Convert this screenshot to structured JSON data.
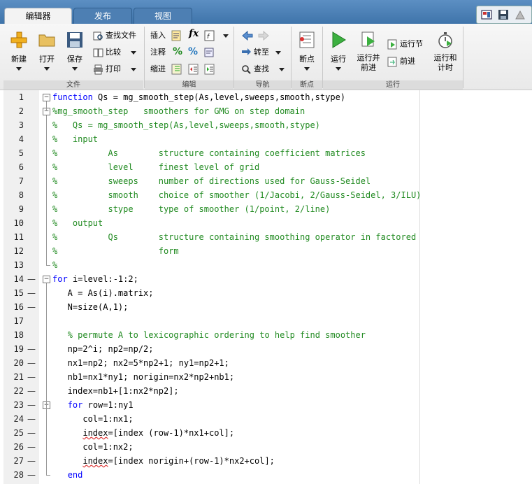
{
  "tabs": [
    {
      "label": "编辑器",
      "active": true
    },
    {
      "label": "发布",
      "active": false
    },
    {
      "label": "视图",
      "active": false
    }
  ],
  "quick_access": [
    "layout-icon",
    "save-icon",
    "help-icon"
  ],
  "ribbon": {
    "file": {
      "new": "新建",
      "open": "打开",
      "save": "保存",
      "find_files": "查找文件",
      "compare": "比较",
      "print": "打印",
      "group": "文件"
    },
    "edit": {
      "insert": "插入",
      "comment": "注释",
      "indent": "缩进",
      "group": "编辑"
    },
    "navigate": {
      "goto": "转至",
      "find": "查找",
      "group": "导航"
    },
    "breakpoints": {
      "breakpoint": "断点",
      "group": "断点"
    },
    "run": {
      "run": "运行",
      "run_advance": "运行并\n前进",
      "run_section": "运行节",
      "advance": "前进",
      "run_time": "运行和\n计时",
      "group": "运行"
    }
  },
  "colors": {
    "keyword": "#0000ff",
    "comment": "#228b22",
    "tab_bar": "#4a7fb5"
  },
  "code_lines": [
    {
      "n": "1",
      "dash": false,
      "fold": "minus",
      "parts": [
        [
          "kw",
          "function"
        ],
        [
          "t",
          " Qs = mg_smooth_step(As,level,sweeps,smooth,stype)"
        ]
      ]
    },
    {
      "n": "2",
      "dash": false,
      "fold": "minus",
      "parts": [
        [
          "cm",
          "%mg_smooth_step   smoothers for GMG on step domain"
        ]
      ]
    },
    {
      "n": "3",
      "dash": false,
      "fold": "",
      "parts": [
        [
          "cm",
          "%   Qs = mg_smooth_step(As,level,sweeps,smooth,stype)"
        ]
      ]
    },
    {
      "n": "4",
      "dash": false,
      "fold": "",
      "parts": [
        [
          "cm",
          "%   input"
        ]
      ]
    },
    {
      "n": "5",
      "dash": false,
      "fold": "",
      "parts": [
        [
          "cm",
          "%          As        structure containing coefficient matrices"
        ]
      ]
    },
    {
      "n": "6",
      "dash": false,
      "fold": "",
      "parts": [
        [
          "cm",
          "%          level     finest level of grid"
        ]
      ]
    },
    {
      "n": "7",
      "dash": false,
      "fold": "",
      "parts": [
        [
          "cm",
          "%          sweeps    number of directions used for Gauss-Seidel"
        ]
      ]
    },
    {
      "n": "8",
      "dash": false,
      "fold": "",
      "parts": [
        [
          "cm",
          "%          smooth    choice of smoother (1/Jacobi, 2/Gauss-Seidel, 3/ILU)"
        ]
      ]
    },
    {
      "n": "9",
      "dash": false,
      "fold": "",
      "parts": [
        [
          "cm",
          "%          stype     type of smoother (1/point, 2/line)"
        ]
      ]
    },
    {
      "n": "10",
      "dash": false,
      "fold": "",
      "parts": [
        [
          "cm",
          "%   output"
        ]
      ]
    },
    {
      "n": "11",
      "dash": false,
      "fold": "",
      "parts": [
        [
          "cm",
          "%          Qs        structure containing smoothing operator in factored"
        ]
      ]
    },
    {
      "n": "12",
      "dash": false,
      "fold": "",
      "parts": [
        [
          "cm",
          "%                    form"
        ]
      ]
    },
    {
      "n": "13",
      "dash": false,
      "fold": "end",
      "parts": [
        [
          "cm",
          "%"
        ]
      ]
    },
    {
      "n": "14",
      "dash": true,
      "fold": "minus",
      "parts": [
        [
          "kw",
          "for"
        ],
        [
          "t",
          " i=level:-1:2;"
        ]
      ]
    },
    {
      "n": "15",
      "dash": true,
      "fold": "",
      "parts": [
        [
          "t",
          "   A = As(i).matrix;"
        ]
      ]
    },
    {
      "n": "16",
      "dash": true,
      "fold": "",
      "parts": [
        [
          "t",
          "   N=size(A,1);"
        ]
      ]
    },
    {
      "n": "17",
      "dash": false,
      "fold": "",
      "parts": [
        [
          "t",
          ""
        ]
      ]
    },
    {
      "n": "18",
      "dash": false,
      "fold": "",
      "parts": [
        [
          "t",
          "   "
        ],
        [
          "cm",
          "% permute A to lexicographic ordering to help find smoother"
        ]
      ]
    },
    {
      "n": "19",
      "dash": true,
      "fold": "",
      "parts": [
        [
          "t",
          "   np=2^i; np2=np/2;"
        ]
      ]
    },
    {
      "n": "20",
      "dash": true,
      "fold": "",
      "parts": [
        [
          "t",
          "   nx1=np2; nx2=5*np2+1; ny1=np2+1;"
        ]
      ]
    },
    {
      "n": "21",
      "dash": true,
      "fold": "",
      "parts": [
        [
          "t",
          "   nb1=nx1*ny1; norigin=nx2*np2+nb1;"
        ]
      ]
    },
    {
      "n": "22",
      "dash": true,
      "fold": "",
      "parts": [
        [
          "t",
          "   index=nb1+[1:nx2*np2];"
        ]
      ]
    },
    {
      "n": "23",
      "dash": true,
      "fold": "minus",
      "parts": [
        [
          "t",
          "   "
        ],
        [
          "kw",
          "for"
        ],
        [
          "t",
          " row=1:ny1"
        ]
      ]
    },
    {
      "n": "24",
      "dash": true,
      "fold": "",
      "parts": [
        [
          "t",
          "      col=1:nx1;"
        ]
      ]
    },
    {
      "n": "25",
      "dash": true,
      "fold": "",
      "parts": [
        [
          "t",
          "      "
        ],
        [
          "sq",
          "index"
        ],
        [
          "t",
          "=[index (row-1)*nx1+col];"
        ]
      ]
    },
    {
      "n": "26",
      "dash": true,
      "fold": "",
      "parts": [
        [
          "t",
          "      col=1:nx2;"
        ]
      ]
    },
    {
      "n": "27",
      "dash": true,
      "fold": "",
      "parts": [
        [
          "t",
          "      "
        ],
        [
          "sq",
          "index"
        ],
        [
          "t",
          "=[index norigin+(row-1)*nx2+col];"
        ]
      ]
    },
    {
      "n": "28",
      "dash": true,
      "fold": "end",
      "parts": [
        [
          "t",
          "   "
        ],
        [
          "kw",
          "end"
        ]
      ]
    }
  ]
}
